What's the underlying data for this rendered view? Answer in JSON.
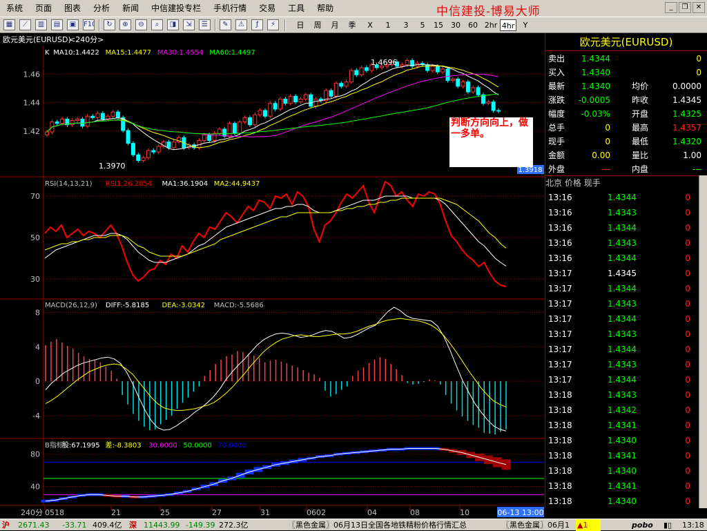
{
  "menu": [
    "系统",
    "页面",
    "图表",
    "分析",
    "新闻",
    "中信建投专栏",
    "手机行情",
    "交易",
    "工具",
    "帮助"
  ],
  "brand_title": "中信建投-博易大师",
  "toolbar": {
    "periods": [
      "日",
      "周",
      "月",
      "季",
      "X",
      "1",
      "3",
      "5",
      "15",
      "30",
      "60",
      "2hr",
      "4hr",
      "Y"
    ],
    "active_period": "4hr"
  },
  "chart_header": {
    "symbol": "欧元美元(EURUSD)",
    "period": "<240分>"
  },
  "main_panel": {
    "legend": [
      {
        "text": "K",
        "color": "#ffffff"
      },
      {
        "text": "MA10:1.4422",
        "color": "#ffffff"
      },
      {
        "text": "MA15:1.4477",
        "color": "#ffff00"
      },
      {
        "text": "MA30:1.4554",
        "color": "#ff00ff"
      },
      {
        "text": "MA60:1.4497",
        "color": "#00ff00"
      }
    ],
    "high_label": "1.4696",
    "low_label": "1.3970",
    "current_price_tag": "1.3918"
  },
  "rsi_panel": {
    "legend": [
      {
        "text": "RSI(14,13,21)",
        "color": "#c0c0c0"
      },
      {
        "text": "RSI1:26.2854",
        "color": "#ff0000"
      },
      {
        "text": "MA1:36.1904",
        "color": "#ffffff"
      },
      {
        "text": "MA2:44.9437",
        "color": "#ffff00"
      }
    ]
  },
  "macd_panel": {
    "legend": [
      {
        "text": "MACD(26,12,9)",
        "color": "#c0c0c0"
      },
      {
        "text": "DIFF:-5.8185",
        "color": "#ffffff"
      },
      {
        "text": "DEA:-3.0342",
        "color": "#ffff00"
      },
      {
        "text": "MACD:-5.5686",
        "color": "#c0c0c0"
      }
    ]
  },
  "b_panel": {
    "legend": [
      {
        "text": "B指标",
        "color": "#c0c0c0"
      },
      {
        "text": "股:67.1995",
        "color": "#ffffff"
      },
      {
        "text": "差:-8.3803",
        "color": "#ffff00"
      },
      {
        "text": "30.0000",
        "color": "#ff00ff"
      },
      {
        "text": "50.0000",
        "color": "#00ff00"
      },
      {
        "text": "70.0000",
        "color": "#0000ff"
      }
    ]
  },
  "note_text": "判断方向向上，做一多单。",
  "x_axis": {
    "period_label": "240分",
    "labels": [
      "0518",
      "21",
      "25",
      "27",
      "31",
      "0602",
      "04",
      "08",
      "10"
    ],
    "current_time": "06-13 13:00"
  },
  "quote": {
    "title": "欧元美元(EURUSD)",
    "rows": [
      {
        "l1": "卖出",
        "v1": "1.4344",
        "c1": "#00ff00",
        "l2": "",
        "v2": "0",
        "c2": "#ffff00"
      },
      {
        "l1": "买入",
        "v1": "1.4340",
        "c1": "#00ff00",
        "l2": "",
        "v2": "0",
        "c2": "#ffff00"
      },
      {
        "l1": "最新",
        "v1": "1.4340",
        "c1": "#00ff00",
        "l2": "均价",
        "v2": "0.0000",
        "c2": "#ffffff"
      },
      {
        "l1": "涨跌",
        "v1": "-0.0005",
        "c1": "#00ff00",
        "l2": "昨收",
        "v2": "1.4345",
        "c2": "#ffffff"
      },
      {
        "l1": "幅度",
        "v1": "-0.03%",
        "c1": "#00ff00",
        "l2": "开盘",
        "v2": "1.4325",
        "c2": "#00ff00"
      },
      {
        "l1": "总手",
        "v1": "0",
        "c1": "#ffff00",
        "l2": "最高",
        "v2": "1.4357",
        "c2": "#ff2020"
      },
      {
        "l1": "现手",
        "v1": "0",
        "c1": "#ffff00",
        "l2": "最低",
        "v2": "1.4320",
        "c2": "#00ff00"
      },
      {
        "l1": "金额",
        "v1": "0.00",
        "c1": "#ffff00",
        "l2": "量比",
        "v2": "1.00",
        "c2": "#ffffff"
      },
      {
        "l1": "外盘",
        "v1": "---",
        "c1": "#ff2020",
        "l2": "内盘",
        "v2": "---",
        "c2": "#00ff00"
      }
    ]
  },
  "ticks": {
    "headers": [
      "北京",
      "价格",
      "现手"
    ],
    "rows": [
      {
        "time": "13:16",
        "price": "1.4344",
        "vol": "0",
        "color": "#00ff00"
      },
      {
        "time": "13:16",
        "price": "1.4343",
        "vol": "0",
        "color": "#00ff00"
      },
      {
        "time": "13:16",
        "price": "1.4344",
        "vol": "0",
        "color": "#00ff00"
      },
      {
        "time": "13:16",
        "price": "1.4343",
        "vol": "0",
        "color": "#00ff00"
      },
      {
        "time": "13:16",
        "price": "1.4344",
        "vol": "0",
        "color": "#00ff00"
      },
      {
        "time": "13:17",
        "price": "1.4345",
        "vol": "0",
        "color": "#ffffff"
      },
      {
        "time": "13:17",
        "price": "1.4344",
        "vol": "0",
        "color": "#00ff00"
      },
      {
        "time": "13:17",
        "price": "1.4343",
        "vol": "0",
        "color": "#00ff00"
      },
      {
        "time": "13:17",
        "price": "1.4344",
        "vol": "0",
        "color": "#00ff00"
      },
      {
        "time": "13:17",
        "price": "1.4343",
        "vol": "0",
        "color": "#00ff00"
      },
      {
        "time": "13:17",
        "price": "1.4344",
        "vol": "0",
        "color": "#00ff00"
      },
      {
        "time": "13:17",
        "price": "1.4343",
        "vol": "0",
        "color": "#00ff00"
      },
      {
        "time": "13:17",
        "price": "1.4344",
        "vol": "0",
        "color": "#00ff00"
      },
      {
        "time": "13:18",
        "price": "1.4343",
        "vol": "0",
        "color": "#00ff00"
      },
      {
        "time": "13:18",
        "price": "1.4342",
        "vol": "0",
        "color": "#00ff00"
      },
      {
        "time": "13:18",
        "price": "1.4341",
        "vol": "0",
        "color": "#00ff00"
      },
      {
        "time": "13:18",
        "price": "1.4340",
        "vol": "0",
        "color": "#00ff00"
      },
      {
        "time": "13:18",
        "price": "1.4341",
        "vol": "0",
        "color": "#00ff00"
      },
      {
        "time": "13:18",
        "price": "1.4340",
        "vol": "0",
        "color": "#00ff00"
      },
      {
        "time": "13:18",
        "price": "1.4341",
        "vol": "0",
        "color": "#00ff00"
      },
      {
        "time": "13:18",
        "price": "1.4340",
        "vol": "0",
        "color": "#00ff00"
      }
    ]
  },
  "status": {
    "sh_label": "沪",
    "sh_value": "2671.43",
    "sh_change": "-33.71",
    "sh_amount": "409.4亿",
    "sz_label": "深",
    "sz_value": "11443.99",
    "sz_change": "-149.39",
    "sz_amount": "272.3亿",
    "news1": "〖黑色金属〗06月13日全国各地铁精粉价格行情汇总",
    "news2": "〖黑色金属〗06月1",
    "alert": "1",
    "logo": "pobo",
    "clock": "13:18"
  },
  "chart_data": [
    {
      "type": "candlestick",
      "title": "欧元美元(EURUSD) <240分>",
      "y_ticks": [
        "1.46",
        "1.44",
        "1.42"
      ],
      "ylim": [
        1.392,
        1.478
      ],
      "x_labels": [
        "0518",
        "21",
        "25",
        "27",
        "31",
        "0602",
        "04",
        "08",
        "10"
      ],
      "annotations": [
        "1.4696",
        "1.3970"
      ],
      "close": [
        1.4195,
        1.4265,
        1.4255,
        1.4285,
        1.4245,
        1.4275,
        1.4285,
        1.4235,
        1.4305,
        1.4295,
        1.4325,
        1.4285,
        1.4305,
        1.4335,
        1.4295,
        1.4205,
        1.4115,
        1.4035,
        1.3995,
        1.4015,
        1.4065,
        1.4055,
        1.4095,
        1.4125,
        1.4085,
        1.4125,
        1.4155,
        1.4085,
        1.4105,
        1.4085,
        1.4135,
        1.4175,
        1.4135,
        1.4185,
        1.4215,
        1.4165,
        1.4255,
        1.4185,
        1.4265,
        1.4295,
        1.4245,
        1.4315,
        1.4345,
        1.4305,
        1.4395,
        1.4355,
        1.4425,
        1.4395,
        1.4445,
        1.4405,
        1.4425,
        1.4455,
        1.4375,
        1.4425,
        1.4415,
        1.4485,
        1.4445,
        1.4535,
        1.4515,
        1.4545,
        1.4625,
        1.4595,
        1.4645,
        1.4625,
        1.4665,
        1.4645,
        1.4655,
        1.4665,
        1.4685,
        1.4655,
        1.4665,
        1.4695,
        1.4655,
        1.4675,
        1.4665,
        1.4625,
        1.4655,
        1.4615,
        1.4635,
        1.4555,
        1.4565,
        1.4515,
        1.4545,
        1.4475,
        1.4505,
        1.4455,
        1.4395,
        1.4405,
        1.4345,
        1.434
      ]
    },
    {
      "type": "line",
      "title": "RSI(14,13,21)",
      "y_ticks": [
        "70",
        "50",
        "30"
      ],
      "ylim": [
        22,
        78
      ],
      "series": [
        {
          "name": "RSI1",
          "color": "#ff0000",
          "values": [
            52,
            55,
            53,
            56,
            50,
            52,
            54,
            51,
            53,
            52,
            50,
            53,
            56,
            52,
            46,
            38,
            32,
            29,
            31,
            34,
            35,
            39,
            37,
            42,
            40,
            46,
            43,
            48,
            52,
            50,
            55,
            54,
            58,
            62,
            60,
            57,
            61,
            65,
            63,
            68,
            67,
            64,
            70,
            69,
            71,
            66,
            72,
            70,
            65,
            54,
            48,
            56,
            58,
            62,
            67,
            71,
            69,
            72,
            75,
            67,
            62,
            70,
            77,
            75,
            70,
            72,
            68,
            65,
            71,
            70,
            72,
            71,
            66,
            58,
            51,
            48,
            44,
            41,
            39,
            36,
            38,
            33,
            29,
            27,
            26.3
          ]
        },
        {
          "name": "MA1",
          "color": "#ffffff",
          "values": [
            40,
            42,
            44,
            45,
            46,
            47,
            48,
            49,
            50,
            51,
            51,
            51,
            52,
            52,
            51,
            49,
            46,
            43,
            41,
            39,
            38,
            38,
            38,
            39,
            40,
            41,
            42,
            44,
            46,
            47,
            49,
            51,
            53,
            55,
            56,
            57,
            58,
            59,
            60,
            61,
            62,
            63,
            64,
            64,
            65,
            65,
            66,
            66,
            65,
            63,
            62,
            62,
            62,
            63,
            64,
            65,
            66,
            67,
            68,
            68,
            68,
            69,
            70,
            70,
            70,
            70,
            70,
            69,
            69,
            69,
            69,
            69,
            68,
            66,
            63,
            60,
            57,
            54,
            51,
            48,
            46,
            43,
            40,
            38,
            36.2
          ]
        },
        {
          "name": "MA2",
          "color": "#ffff00",
          "values": [
            44,
            45,
            46,
            47,
            47,
            48,
            48,
            49,
            49,
            50,
            50,
            50,
            51,
            51,
            51,
            50,
            48,
            46,
            45,
            43,
            42,
            41,
            41,
            41,
            41,
            41,
            42,
            43,
            44,
            45,
            46,
            47,
            49,
            50,
            51,
            52,
            53,
            54,
            55,
            56,
            57,
            58,
            59,
            60,
            60,
            61,
            62,
            62,
            62,
            62,
            62,
            62,
            62,
            63,
            63,
            64,
            64,
            65,
            65,
            66,
            66,
            67,
            67,
            68,
            68,
            69,
            69,
            69,
            69,
            69,
            69,
            69,
            69,
            68,
            67,
            66,
            64,
            62,
            60,
            58,
            55,
            52,
            50,
            47,
            44.9
          ]
        }
      ]
    },
    {
      "type": "bar",
      "title": "MACD(26,12,9)",
      "y_ticks": [
        "8",
        "4",
        "0",
        "-4"
      ],
      "ylim": [
        -6.5,
        9
      ],
      "series": [
        {
          "name": "MACD",
          "values": [
            4.2,
            4.6,
            4.9,
            4.5,
            4.1,
            3.8,
            3.3,
            2.9,
            2.6,
            2.5,
            2.2,
            1.7,
            1.2,
            0.3,
            -1.6,
            -2.7,
            -3.8,
            -4.6,
            -5.3,
            -5.7,
            -5.6,
            -5.0,
            -4.5,
            -4.0,
            -3.2,
            -2.5,
            -1.9,
            -1.2,
            -0.6,
            0.6,
            1.3,
            2.0,
            2.5,
            2.9,
            3.1,
            3.5,
            3.4,
            3.2,
            3.0,
            2.7,
            2.2,
            2.4,
            2.5,
            2.3,
            2.1,
            1.8,
            1.6,
            1.3,
            1.0,
            0.8,
            0.4,
            -1.1,
            -1.8,
            -1.5,
            -1.0,
            -0.6,
            0.6,
            1.2,
            1.6,
            2.1,
            2.5,
            2.8,
            2.6,
            2.0,
            1.4,
            0.7,
            -0.2,
            -0.4,
            -0.3,
            -0.1,
            0.2,
            0.1,
            -0.4,
            -1.6,
            -2.6,
            -3.4,
            -4.1,
            -4.6,
            -5.1,
            -5.4,
            -6.0,
            -6.1,
            -6.2,
            -5.9,
            -5.6
          ]
        },
        {
          "name": "DIFF",
          "color": "#ffffff",
          "values": [
            -1.0,
            -0.2,
            0.4,
            1.0,
            1.4,
            1.8,
            2.1,
            2.3,
            2.5,
            2.7,
            2.8,
            2.6,
            2.1,
            1.1,
            -0.3,
            -1.9,
            -3.4,
            -4.6,
            -5.4,
            -5.7,
            -5.6,
            -5.2,
            -4.7,
            -4.2,
            -3.6,
            -3.1,
            -2.5,
            -1.8,
            -0.9,
            0.2,
            1.1,
            1.9,
            2.6,
            3.4,
            4.2,
            4.8,
            5.2,
            5.5,
            5.6,
            5.5,
            5.3,
            5.1,
            5.2,
            5.4,
            5.7,
            5.9,
            5.8,
            5.4,
            5.0,
            5.1,
            5.4,
            5.8,
            6.2,
            6.5,
            7.3,
            8.1,
            8.6,
            8.2,
            7.6,
            7.3,
            7.2,
            7.1,
            7.0,
            6.4,
            5.2,
            3.6,
            1.8,
            0.1,
            -1.3,
            -2.6,
            -3.6,
            -4.5,
            -5.2,
            -5.6,
            -5.8
          ]
        },
        {
          "name": "DEA",
          "color": "#ffff00",
          "values": [
            -2.6,
            -2.2,
            -1.7,
            -1.1,
            -0.5,
            0.1,
            0.6,
            1.1,
            1.4,
            1.7,
            1.9,
            2.0,
            1.9,
            1.4,
            0.8,
            -0.1,
            -1.0,
            -1.9,
            -2.6,
            -3.1,
            -3.3,
            -3.4,
            -3.4,
            -3.3,
            -3.2,
            -3.0,
            -2.8,
            -2.5,
            -2.0,
            -1.4,
            -0.7,
            0.1,
            0.9,
            1.8,
            2.6,
            3.4,
            4.0,
            4.5,
            4.9,
            5.1,
            5.3,
            5.4,
            5.3,
            5.2,
            5.2,
            5.3,
            5.4,
            5.5,
            5.5,
            5.6,
            5.8,
            6.1,
            6.4,
            6.6,
            6.9,
            7.1,
            7.2,
            7.3,
            7.2,
            7.1,
            7.0,
            6.8,
            6.5,
            6.0,
            5.3,
            4.4,
            3.4,
            2.3,
            1.2,
            0.2,
            -0.8,
            -1.6,
            -2.3,
            -2.7,
            -3.0
          ]
        }
      ]
    },
    {
      "type": "area",
      "title": "B指标",
      "y_ticks": [
        "80",
        "40"
      ],
      "ylim": [
        20,
        90
      ],
      "series": [
        {
          "name": "股",
          "color": "#1030ff",
          "values": [
            22,
            23,
            25,
            27,
            29,
            30,
            30,
            29,
            28,
            28,
            27,
            27,
            28,
            29,
            30,
            32,
            34,
            37,
            40,
            43,
            47,
            50,
            54,
            58,
            61,
            64,
            67,
            69,
            71,
            73,
            75,
            77,
            78,
            80,
            81,
            82,
            83,
            84,
            85,
            86,
            86,
            87,
            87,
            87,
            87,
            86,
            84,
            82,
            79,
            76,
            73,
            70,
            67.2
          ]
        },
        {
          "name": "差",
          "color": "#ffff00",
          "values": [
            0,
            0,
            1,
            1,
            1,
            1,
            0,
            0,
            0,
            -1,
            -1,
            -1,
            0,
            0,
            1,
            1,
            2,
            2,
            3,
            3,
            3,
            3,
            4,
            4,
            4,
            3,
            3,
            3,
            3,
            3,
            2,
            2,
            2,
            2,
            1,
            1,
            1,
            1,
            1,
            0,
            0,
            0,
            0,
            -1,
            -1,
            -2,
            -3,
            -4,
            -5,
            -6,
            -7,
            -8,
            -8.4
          ]
        }
      ],
      "reference_lines": [
        30,
        50,
        70
      ]
    }
  ]
}
